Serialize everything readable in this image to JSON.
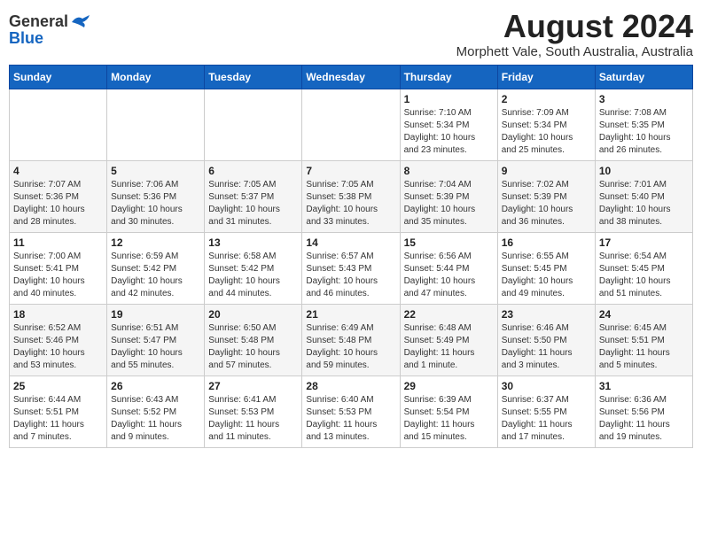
{
  "header": {
    "logo_general": "General",
    "logo_blue": "Blue",
    "month_title": "August 2024",
    "location": "Morphett Vale, South Australia, Australia"
  },
  "weekdays": [
    "Sunday",
    "Monday",
    "Tuesday",
    "Wednesday",
    "Thursday",
    "Friday",
    "Saturday"
  ],
  "weeks": [
    [
      {
        "day": "",
        "info": ""
      },
      {
        "day": "",
        "info": ""
      },
      {
        "day": "",
        "info": ""
      },
      {
        "day": "",
        "info": ""
      },
      {
        "day": "1",
        "info": "Sunrise: 7:10 AM\nSunset: 5:34 PM\nDaylight: 10 hours\nand 23 minutes."
      },
      {
        "day": "2",
        "info": "Sunrise: 7:09 AM\nSunset: 5:34 PM\nDaylight: 10 hours\nand 25 minutes."
      },
      {
        "day": "3",
        "info": "Sunrise: 7:08 AM\nSunset: 5:35 PM\nDaylight: 10 hours\nand 26 minutes."
      }
    ],
    [
      {
        "day": "4",
        "info": "Sunrise: 7:07 AM\nSunset: 5:36 PM\nDaylight: 10 hours\nand 28 minutes."
      },
      {
        "day": "5",
        "info": "Sunrise: 7:06 AM\nSunset: 5:36 PM\nDaylight: 10 hours\nand 30 minutes."
      },
      {
        "day": "6",
        "info": "Sunrise: 7:05 AM\nSunset: 5:37 PM\nDaylight: 10 hours\nand 31 minutes."
      },
      {
        "day": "7",
        "info": "Sunrise: 7:05 AM\nSunset: 5:38 PM\nDaylight: 10 hours\nand 33 minutes."
      },
      {
        "day": "8",
        "info": "Sunrise: 7:04 AM\nSunset: 5:39 PM\nDaylight: 10 hours\nand 35 minutes."
      },
      {
        "day": "9",
        "info": "Sunrise: 7:02 AM\nSunset: 5:39 PM\nDaylight: 10 hours\nand 36 minutes."
      },
      {
        "day": "10",
        "info": "Sunrise: 7:01 AM\nSunset: 5:40 PM\nDaylight: 10 hours\nand 38 minutes."
      }
    ],
    [
      {
        "day": "11",
        "info": "Sunrise: 7:00 AM\nSunset: 5:41 PM\nDaylight: 10 hours\nand 40 minutes."
      },
      {
        "day": "12",
        "info": "Sunrise: 6:59 AM\nSunset: 5:42 PM\nDaylight: 10 hours\nand 42 minutes."
      },
      {
        "day": "13",
        "info": "Sunrise: 6:58 AM\nSunset: 5:42 PM\nDaylight: 10 hours\nand 44 minutes."
      },
      {
        "day": "14",
        "info": "Sunrise: 6:57 AM\nSunset: 5:43 PM\nDaylight: 10 hours\nand 46 minutes."
      },
      {
        "day": "15",
        "info": "Sunrise: 6:56 AM\nSunset: 5:44 PM\nDaylight: 10 hours\nand 47 minutes."
      },
      {
        "day": "16",
        "info": "Sunrise: 6:55 AM\nSunset: 5:45 PM\nDaylight: 10 hours\nand 49 minutes."
      },
      {
        "day": "17",
        "info": "Sunrise: 6:54 AM\nSunset: 5:45 PM\nDaylight: 10 hours\nand 51 minutes."
      }
    ],
    [
      {
        "day": "18",
        "info": "Sunrise: 6:52 AM\nSunset: 5:46 PM\nDaylight: 10 hours\nand 53 minutes."
      },
      {
        "day": "19",
        "info": "Sunrise: 6:51 AM\nSunset: 5:47 PM\nDaylight: 10 hours\nand 55 minutes."
      },
      {
        "day": "20",
        "info": "Sunrise: 6:50 AM\nSunset: 5:48 PM\nDaylight: 10 hours\nand 57 minutes."
      },
      {
        "day": "21",
        "info": "Sunrise: 6:49 AM\nSunset: 5:48 PM\nDaylight: 10 hours\nand 59 minutes."
      },
      {
        "day": "22",
        "info": "Sunrise: 6:48 AM\nSunset: 5:49 PM\nDaylight: 11 hours\nand 1 minute."
      },
      {
        "day": "23",
        "info": "Sunrise: 6:46 AM\nSunset: 5:50 PM\nDaylight: 11 hours\nand 3 minutes."
      },
      {
        "day": "24",
        "info": "Sunrise: 6:45 AM\nSunset: 5:51 PM\nDaylight: 11 hours\nand 5 minutes."
      }
    ],
    [
      {
        "day": "25",
        "info": "Sunrise: 6:44 AM\nSunset: 5:51 PM\nDaylight: 11 hours\nand 7 minutes."
      },
      {
        "day": "26",
        "info": "Sunrise: 6:43 AM\nSunset: 5:52 PM\nDaylight: 11 hours\nand 9 minutes."
      },
      {
        "day": "27",
        "info": "Sunrise: 6:41 AM\nSunset: 5:53 PM\nDaylight: 11 hours\nand 11 minutes."
      },
      {
        "day": "28",
        "info": "Sunrise: 6:40 AM\nSunset: 5:53 PM\nDaylight: 11 hours\nand 13 minutes."
      },
      {
        "day": "29",
        "info": "Sunrise: 6:39 AM\nSunset: 5:54 PM\nDaylight: 11 hours\nand 15 minutes."
      },
      {
        "day": "30",
        "info": "Sunrise: 6:37 AM\nSunset: 5:55 PM\nDaylight: 11 hours\nand 17 minutes."
      },
      {
        "day": "31",
        "info": "Sunrise: 6:36 AM\nSunset: 5:56 PM\nDaylight: 11 hours\nand 19 minutes."
      }
    ]
  ]
}
